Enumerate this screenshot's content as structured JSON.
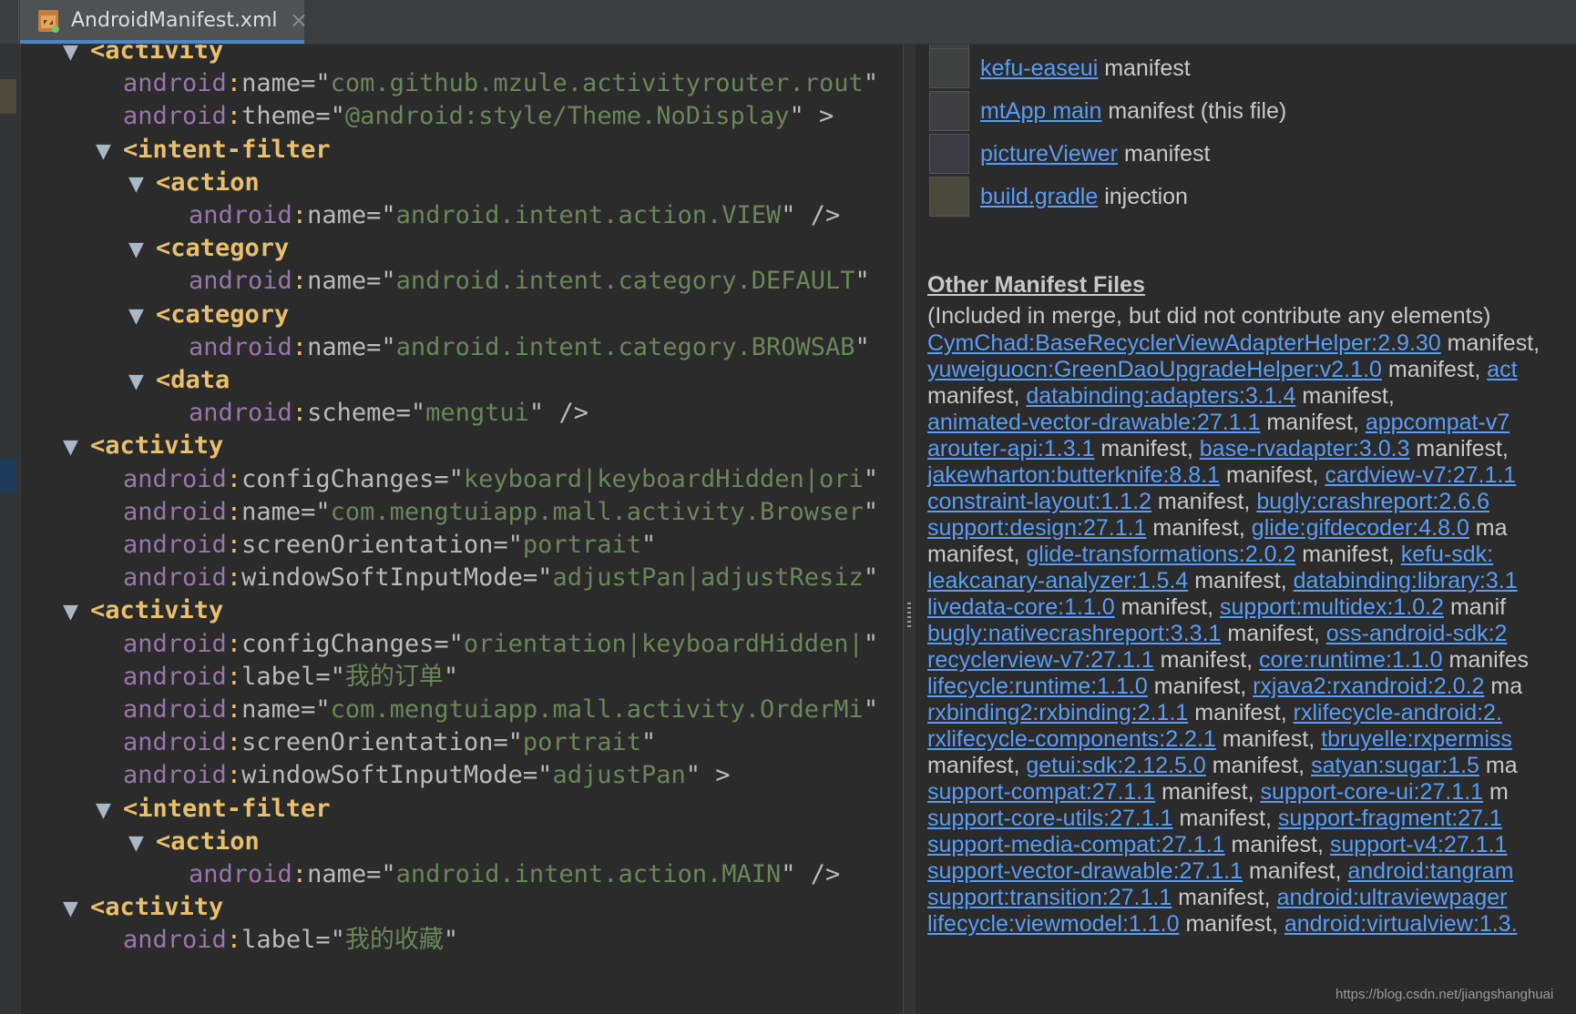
{
  "tab": {
    "title": "AndroidManifest.xml",
    "close": "×"
  },
  "editor": {
    "lines": [
      {
        "indent": 1,
        "arrow": "▼",
        "tag": "<activity"
      },
      {
        "indent": 2,
        "ns": "android",
        "attr": "name",
        "value": "com.github.mzule.activityrouter.rout"
      },
      {
        "indent": 2,
        "ns": "android",
        "attr": "theme",
        "value": "@android:style/Theme.NoDisplay",
        "tail": " >"
      },
      {
        "indent": 2,
        "arrow": "▼",
        "tag": "<intent-filter"
      },
      {
        "indent": 3,
        "arrow": "▼",
        "tag": "<action"
      },
      {
        "indent": 4,
        "ns": "android",
        "attr": "name",
        "value": "android.intent.action.VIEW",
        "tail": " />"
      },
      {
        "indent": 3,
        "arrow": "▼",
        "tag": "<category"
      },
      {
        "indent": 4,
        "ns": "android",
        "attr": "name",
        "value": "android.intent.category.DEFAULT"
      },
      {
        "indent": 3,
        "arrow": "▼",
        "tag": "<category"
      },
      {
        "indent": 4,
        "ns": "android",
        "attr": "name",
        "value": "android.intent.category.BROWSAB"
      },
      {
        "indent": 3,
        "arrow": "▼",
        "tag": "<data"
      },
      {
        "indent": 4,
        "ns": "android",
        "attr": "scheme",
        "value": "mengtui",
        "tail": " />"
      },
      {
        "indent": 1,
        "arrow": "▼",
        "tag": "<activity"
      },
      {
        "indent": 2,
        "ns": "android",
        "attr": "configChanges",
        "value": "keyboard|keyboardHidden|ori"
      },
      {
        "indent": 2,
        "ns": "android",
        "attr": "name",
        "value": "com.mengtuiapp.mall.activity.Browser"
      },
      {
        "indent": 2,
        "ns": "android",
        "attr": "screenOrientation",
        "value": "portrait"
      },
      {
        "indent": 2,
        "ns": "android",
        "attr": "windowSoftInputMode",
        "value": "adjustPan|adjustResiz"
      },
      {
        "indent": 1,
        "arrow": "▼",
        "tag": "<activity"
      },
      {
        "indent": 2,
        "ns": "android",
        "attr": "configChanges",
        "value": "orientation|keyboardHidden|"
      },
      {
        "indent": 2,
        "ns": "android",
        "attr": "label",
        "value": "我的订单"
      },
      {
        "indent": 2,
        "ns": "android",
        "attr": "name",
        "value": "com.mengtuiapp.mall.activity.OrderMi"
      },
      {
        "indent": 2,
        "ns": "android",
        "attr": "screenOrientation",
        "value": "portrait"
      },
      {
        "indent": 2,
        "ns": "android",
        "attr": "windowSoftInputMode",
        "value": "adjustPan",
        "tail": " >"
      },
      {
        "indent": 2,
        "arrow": "▼",
        "tag": "<intent-filter"
      },
      {
        "indent": 3,
        "arrow": "▼",
        "tag": "<action"
      },
      {
        "indent": 4,
        "ns": "android",
        "attr": "name",
        "value": "android.intent.action.MAIN",
        "tail": " />"
      },
      {
        "indent": 1,
        "arrow": "▼",
        "tag": "<activity"
      },
      {
        "indent": 2,
        "ns": "android",
        "attr": "label",
        "value": "我的收藏"
      }
    ]
  },
  "panel": {
    "sources": [
      {
        "link": "kefu-easeui",
        "text": " manifest",
        "color": "#3f4241"
      },
      {
        "link": "mtApp main",
        "text": " manifest (this file)",
        "color": "#3e3d40"
      },
      {
        "link": "pictureViewer",
        "text": " manifest",
        "color": "#3b3a43"
      },
      {
        "link": "build.gradle",
        "text": " injection",
        "color": "#4a4a3b"
      }
    ],
    "other_title": "Other Manifest Files",
    "other_subtitle": "(Included in merge, but did not contribute any elements)",
    "other_lines": [
      [
        {
          "l": "CymChad:BaseRecyclerViewAdapterHelper:2.9.30"
        },
        {
          "t": " manifest,"
        }
      ],
      [
        {
          "l": "yuweiguocn:GreenDaoUpgradeHelper:v2.1.0"
        },
        {
          "t": " manifest, "
        },
        {
          "l": "act"
        }
      ],
      [
        {
          "t": "manifest, "
        },
        {
          "l": "databinding:adapters:3.1.4"
        },
        {
          "t": " manifest,"
        }
      ],
      [
        {
          "l": "animated-vector-drawable:27.1.1"
        },
        {
          "t": " manifest, "
        },
        {
          "l": "appcompat-v7"
        }
      ],
      [
        {
          "l": "arouter-api:1.3.1"
        },
        {
          "t": " manifest, "
        },
        {
          "l": "base-rvadapter:3.0.3"
        },
        {
          "t": " manifest,"
        }
      ],
      [
        {
          "l": "jakewharton:butterknife:8.8.1"
        },
        {
          "t": " manifest, "
        },
        {
          "l": "cardview-v7:27.1.1"
        }
      ],
      [
        {
          "l": "constraint-layout:1.1.2"
        },
        {
          "t": " manifest, "
        },
        {
          "l": "bugly:crashreport:2.6.6"
        }
      ],
      [
        {
          "l": "support:design:27.1.1"
        },
        {
          "t": " manifest, "
        },
        {
          "l": "glide:gifdecoder:4.8.0"
        },
        {
          "t": " ma"
        }
      ],
      [
        {
          "t": "manifest, "
        },
        {
          "l": "glide-transformations:2.0.2"
        },
        {
          "t": " manifest, "
        },
        {
          "l": "kefu-sdk:"
        }
      ],
      [
        {
          "l": "leakcanary-analyzer:1.5.4"
        },
        {
          "t": " manifest, "
        },
        {
          "l": "databinding:library:3.1"
        }
      ],
      [
        {
          "l": "livedata-core:1.1.0"
        },
        {
          "t": " manifest, "
        },
        {
          "l": "support:multidex:1.0.2"
        },
        {
          "t": " manif"
        }
      ],
      [
        {
          "l": "bugly:nativecrashreport:3.3.1"
        },
        {
          "t": " manifest, "
        },
        {
          "l": "oss-android-sdk:2"
        }
      ],
      [
        {
          "l": "recyclerview-v7:27.1.1"
        },
        {
          "t": " manifest, "
        },
        {
          "l": "core:runtime:1.1.0"
        },
        {
          "t": " manifes"
        }
      ],
      [
        {
          "l": "lifecycle:runtime:1.1.0"
        },
        {
          "t": " manifest, "
        },
        {
          "l": "rxjava2:rxandroid:2.0.2"
        },
        {
          "t": " ma"
        }
      ],
      [
        {
          "l": "rxbinding2:rxbinding:2.1.1"
        },
        {
          "t": " manifest, "
        },
        {
          "l": "rxlifecycle-android:2."
        }
      ],
      [
        {
          "l": "rxlifecycle-components:2.2.1"
        },
        {
          "t": " manifest, "
        },
        {
          "l": "tbruyelle:rxpermiss"
        }
      ],
      [
        {
          "t": "manifest, "
        },
        {
          "l": "getui:sdk:2.12.5.0"
        },
        {
          "t": " manifest, "
        },
        {
          "l": "satyan:sugar:1.5"
        },
        {
          "t": " ma"
        }
      ],
      [
        {
          "l": "support-compat:27.1.1"
        },
        {
          "t": " manifest, "
        },
        {
          "l": "support-core-ui:27.1.1"
        },
        {
          "t": " m"
        }
      ],
      [
        {
          "l": "support-core-utils:27.1.1"
        },
        {
          "t": " manifest, "
        },
        {
          "l": "support-fragment:27.1"
        }
      ],
      [
        {
          "l": "support-media-compat:27.1.1"
        },
        {
          "t": " manifest, "
        },
        {
          "l": "support-v4:27.1.1"
        }
      ],
      [
        {
          "l": "support-vector-drawable:27.1.1"
        },
        {
          "t": " manifest, "
        },
        {
          "l": "android:tangram"
        }
      ],
      [
        {
          "l": "support:transition:27.1.1"
        },
        {
          "t": " manifest, "
        },
        {
          "l": "android:ultraviewpager"
        }
      ],
      [
        {
          "l": "lifecycle:viewmodel:1.1.0"
        },
        {
          "t": " manifest, "
        },
        {
          "l": "android:virtualview:1.3."
        }
      ]
    ]
  },
  "watermark": "https://blog.csdn.net/jiangshanghuai"
}
